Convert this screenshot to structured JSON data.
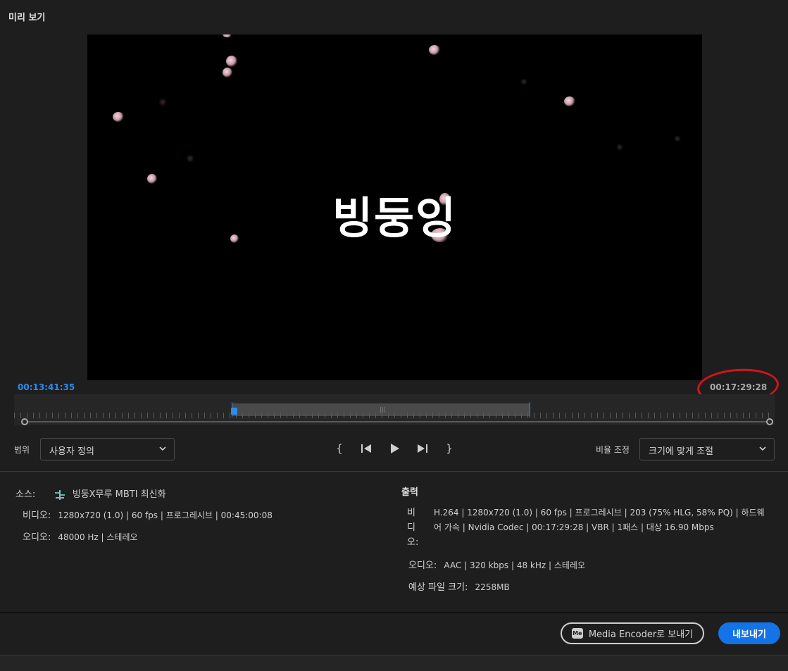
{
  "panel": {
    "title": "미리 보기"
  },
  "preview": {
    "video_title": "빙둥잉"
  },
  "timecode": {
    "current": "00:13:41:35",
    "duration": "00:17:29:28"
  },
  "controls": {
    "range_label": "범위",
    "range_value": "사용자 정의",
    "scale_label": "비율 조정",
    "scale_value": "크기에 맞게 조절",
    "in_point": "{",
    "out_point": "}"
  },
  "source": {
    "label": "소스:",
    "name": "빙둥X무루 MBTI 최신화",
    "video_label": "비디오:",
    "video_value": "1280x720 (1.0) | 60 fps | 프로그레시브 | 00:45:00:08",
    "audio_label": "오디오:",
    "audio_value": "48000 Hz | 스테레오"
  },
  "output": {
    "heading": "출력",
    "video_label": "비디오:",
    "video_value": "H.264 | 1280x720 (1.0) | 60 fps | 프로그레시브 | 203 (75% HLG, 58% PQ) | 하드웨어 가속 | Nvidia Codec | 00:17:29:28  | VBR | 1패스 | 대상 16.90 Mbps",
    "audio_label": "오디오:",
    "audio_value": "AAC | 320 kbps | 48 kHz | 스테레오",
    "size_label": "예상 파일 크기:",
    "size_value": "2258MB"
  },
  "buttons": {
    "encoder_badge": "Me",
    "encoder": "Media Encoder로 보내기",
    "export": "내보내기"
  },
  "colors": {
    "accent": "#1473e6",
    "timecode": "#2d8ceb",
    "annotation": "#d3141b"
  }
}
